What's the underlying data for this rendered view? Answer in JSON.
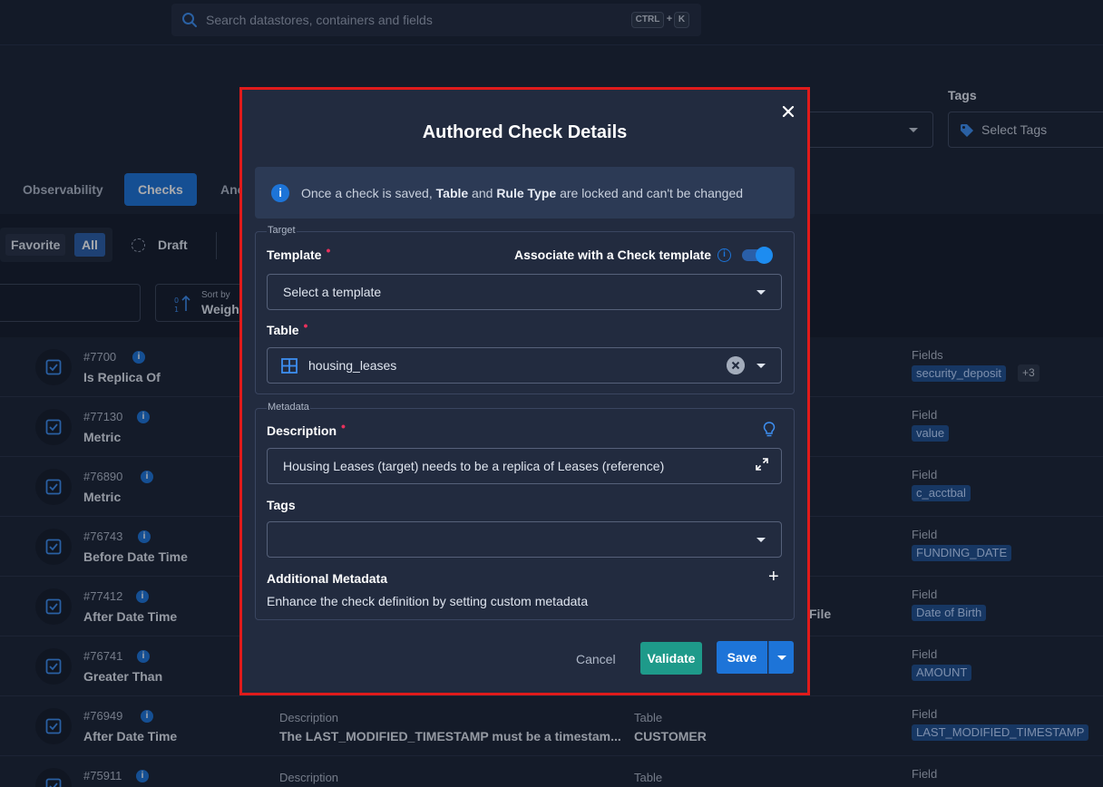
{
  "header": {
    "search_placeholder": "Search datastores, containers and fields",
    "shortcut_ctrl": "CTRL",
    "shortcut_plus": "+",
    "shortcut_key": "K"
  },
  "filters": {
    "tags_label": "Tags",
    "tags_placeholder": "Select Tags"
  },
  "tabs": [
    {
      "label": "Observability"
    },
    {
      "label": "Checks"
    },
    {
      "label": "Ano"
    }
  ],
  "toolbar": {
    "favorite": "Favorite",
    "all": "All",
    "draft": "Draft",
    "sort_by": "Sort by",
    "sort_value": "Weigh"
  },
  "rows": [
    {
      "id": "#7700",
      "name": "Is Replica Of",
      "field_label": "Fields",
      "field": "security_deposit",
      "more": "+3"
    },
    {
      "id": "#77130",
      "name": "Metric",
      "field_label": "Field",
      "field": "value"
    },
    {
      "id": "#76890",
      "name": "Metric",
      "field_label": "Field",
      "field": "c_acctbal"
    },
    {
      "id": "#76743",
      "name": "Before Date Time",
      "field_label": "Field",
      "field": "FUNDING_DATE"
    },
    {
      "id": "#77412",
      "name": "After Date Time",
      "field_label": "Field",
      "field": "Date of Birth",
      "table_tail": "File"
    },
    {
      "id": "#76741",
      "name": "Greater Than",
      "field_label": "Field",
      "field": "AMOUNT"
    },
    {
      "id": "#76949",
      "name": "After Date Time",
      "desc_label": "Description",
      "desc": "The LAST_MODIFIED_TIMESTAMP must be a timestam...",
      "table_label": "Table",
      "table": "CUSTOMER",
      "field_label": "Field",
      "field": "LAST_MODIFIED_TIMESTAMP"
    },
    {
      "id": "#75911",
      "name": "",
      "desc_label": "Description",
      "table_label": "Table",
      "field_label": "Field"
    }
  ],
  "modal": {
    "title": "Authored Check Details",
    "alert": {
      "pre": "Once a check is saved, ",
      "b1": "Table",
      "mid": " and ",
      "b2": "Rule Type",
      "post": " are locked and can't be changed"
    },
    "target_legend": "Target",
    "template_label": "Template",
    "associate_label": "Associate with a Check template",
    "associate_enabled": true,
    "template_placeholder": "Select a template",
    "table_label": "Table",
    "table_value": "housing_leases",
    "metadata_legend": "Metadata",
    "description_label": "Description",
    "description_value": "Housing Leases (target) needs to be a replica of Leases (reference)",
    "tags_label": "Tags",
    "additional_title": "Additional Metadata",
    "additional_desc": "Enhance the check definition by setting custom metadata",
    "cancel": "Cancel",
    "validate": "Validate",
    "save": "Save"
  },
  "colors": {
    "accent": "#1d74d8",
    "validate": "#1e9a8a",
    "highlight_border": "#e01b1b",
    "required": "#e8315c"
  }
}
